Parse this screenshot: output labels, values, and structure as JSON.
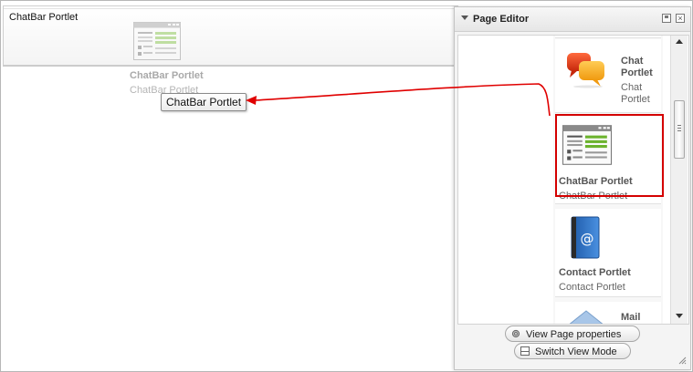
{
  "page": {
    "portlet_title": "ChatBar Portlet",
    "ghost_title": "ChatBar Portlet",
    "ghost_subtitle": "ChatBar Portlet",
    "drag_tooltip": "ChatBar Portlet"
  },
  "editor": {
    "title": "Page Editor",
    "items": [
      {
        "title": "Chat Portlet",
        "title_line1": "Chat",
        "title_line2": "Portlet",
        "sub_line1": "Chat",
        "sub_line2": "Portlet",
        "icon": "chat-bubbles-icon"
      },
      {
        "title": "ChatBar Portlet",
        "subtitle": "ChatBar Portlet",
        "icon": "portlet-window-icon",
        "highlighted": true
      },
      {
        "title": "Contact Portlet",
        "subtitle": "Contact Portlet",
        "icon": "address-book-icon"
      },
      {
        "title_partial": "Mail",
        "icon": "mail-icon"
      }
    ],
    "buttons": {
      "view_page_properties": "View Page properties",
      "switch_view_mode": "Switch View Mode"
    }
  },
  "colors": {
    "highlight": "#d40000",
    "arrow": "#e00000"
  }
}
